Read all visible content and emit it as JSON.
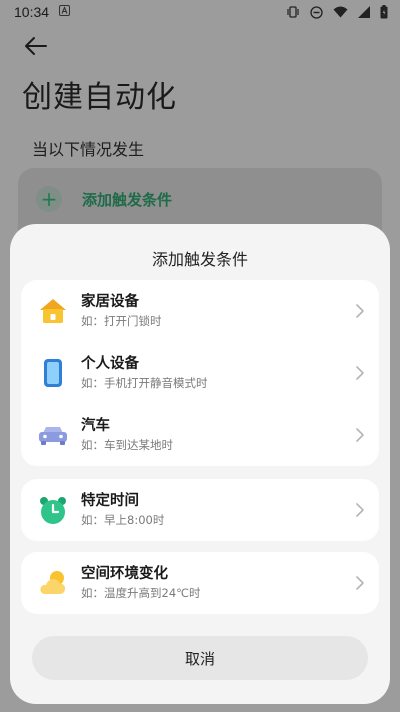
{
  "status_bar": {
    "time": "10:34",
    "icons": [
      "notification-a-icon",
      "vibrate-icon",
      "dnd-icon",
      "wifi-icon",
      "signal-icon",
      "battery-icon"
    ]
  },
  "page": {
    "back_icon": "back-arrow-icon",
    "title": "创建自动化",
    "section_label": "当以下情况发生",
    "add_trigger_label": "添加触发条件",
    "accent_color": "#1f7a52"
  },
  "sheet": {
    "title": "添加触发条件",
    "groups": [
      {
        "items": [
          {
            "icon": "home-icon",
            "title": "家居设备",
            "subtitle": "如：打开门锁时"
          },
          {
            "icon": "phone-icon",
            "title": "个人设备",
            "subtitle": "如：手机打开静音模式时"
          },
          {
            "icon": "car-icon",
            "title": "汽车",
            "subtitle": "如：车到达某地时"
          }
        ]
      },
      {
        "items": [
          {
            "icon": "alarm-clock-icon",
            "title": "特定时间",
            "subtitle": "如：早上8:00时"
          }
        ]
      },
      {
        "items": [
          {
            "icon": "weather-icon",
            "title": "空间环境变化",
            "subtitle": "如：温度升高到24℃时"
          }
        ]
      }
    ],
    "cancel_label": "取消"
  }
}
